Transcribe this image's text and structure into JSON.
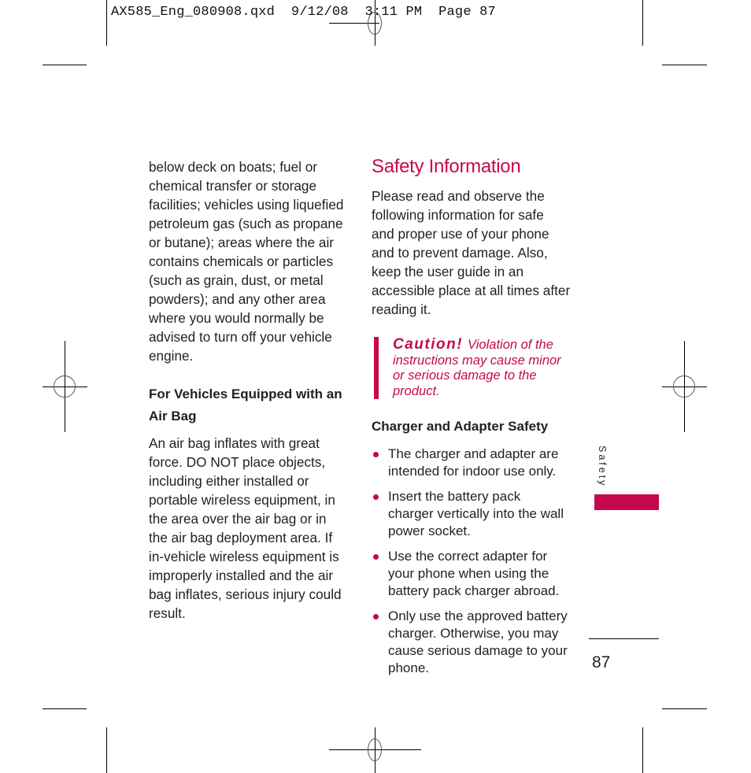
{
  "slug": {
    "filename": "AX585_Eng_080908.qxd",
    "date": "9/12/08",
    "time": "3:11 PM",
    "page_label": "Page 87"
  },
  "left_column": {
    "paragraph_1_lines": [
      "below deck on boats; fuel or",
      "chemical transfer or storage",
      "facilities; vehicles using liquefied",
      "petroleum gas (such as propane",
      "or butane); areas where the air",
      "contains chemicals or particles",
      "(such as grain, dust, or metal",
      "powders); and any other area",
      "where you would normally be",
      "advised to turn off your vehicle",
      "engine."
    ],
    "subheading_lines": [
      "For Vehicles Equipped with an",
      "Air Bag"
    ],
    "paragraph_2_lines": [
      "An air bag inflates with great",
      "force. DO NOT place objects,",
      "including either installed or",
      "portable wireless equipment, in",
      "the area over the air bag or in",
      "the air bag deployment area. If",
      "in-vehicle wireless equipment is",
      "improperly installed and the air",
      "bag inflates, serious injury could",
      "result."
    ]
  },
  "right_column": {
    "title": "Safety Information",
    "intro_lines": [
      "Please read and observe the",
      "following information for safe",
      "and proper use of your phone",
      "and to prevent damage. Also,",
      "keep the user guide in an",
      "accessible place at all times after",
      "reading it."
    ],
    "caution": {
      "label": "Caution!",
      "first_line": "Violation of the",
      "lines": [
        "instructions may cause minor",
        "or serious damage to the",
        "product."
      ]
    },
    "section_heading": "Charger and Adapter Safety",
    "bullets": [
      {
        "lines": [
          "The charger and adapter are",
          "intended for indoor use only."
        ]
      },
      {
        "lines": [
          "Insert the battery pack",
          "charger vertically into the wall",
          "power socket."
        ]
      },
      {
        "lines": [
          "Use the correct adapter for",
          "your phone when using the",
          "battery pack charger abroad."
        ]
      },
      {
        "lines": [
          "Only use the approved battery",
          "charger. Otherwise, you may",
          "cause serious damage to your",
          "phone."
        ]
      }
    ]
  },
  "sidebar": {
    "section_label": "Safety",
    "tab_color": "#c5094f"
  },
  "page_number": "87",
  "colors": {
    "accent": "#c5094f",
    "text": "#231f20"
  }
}
